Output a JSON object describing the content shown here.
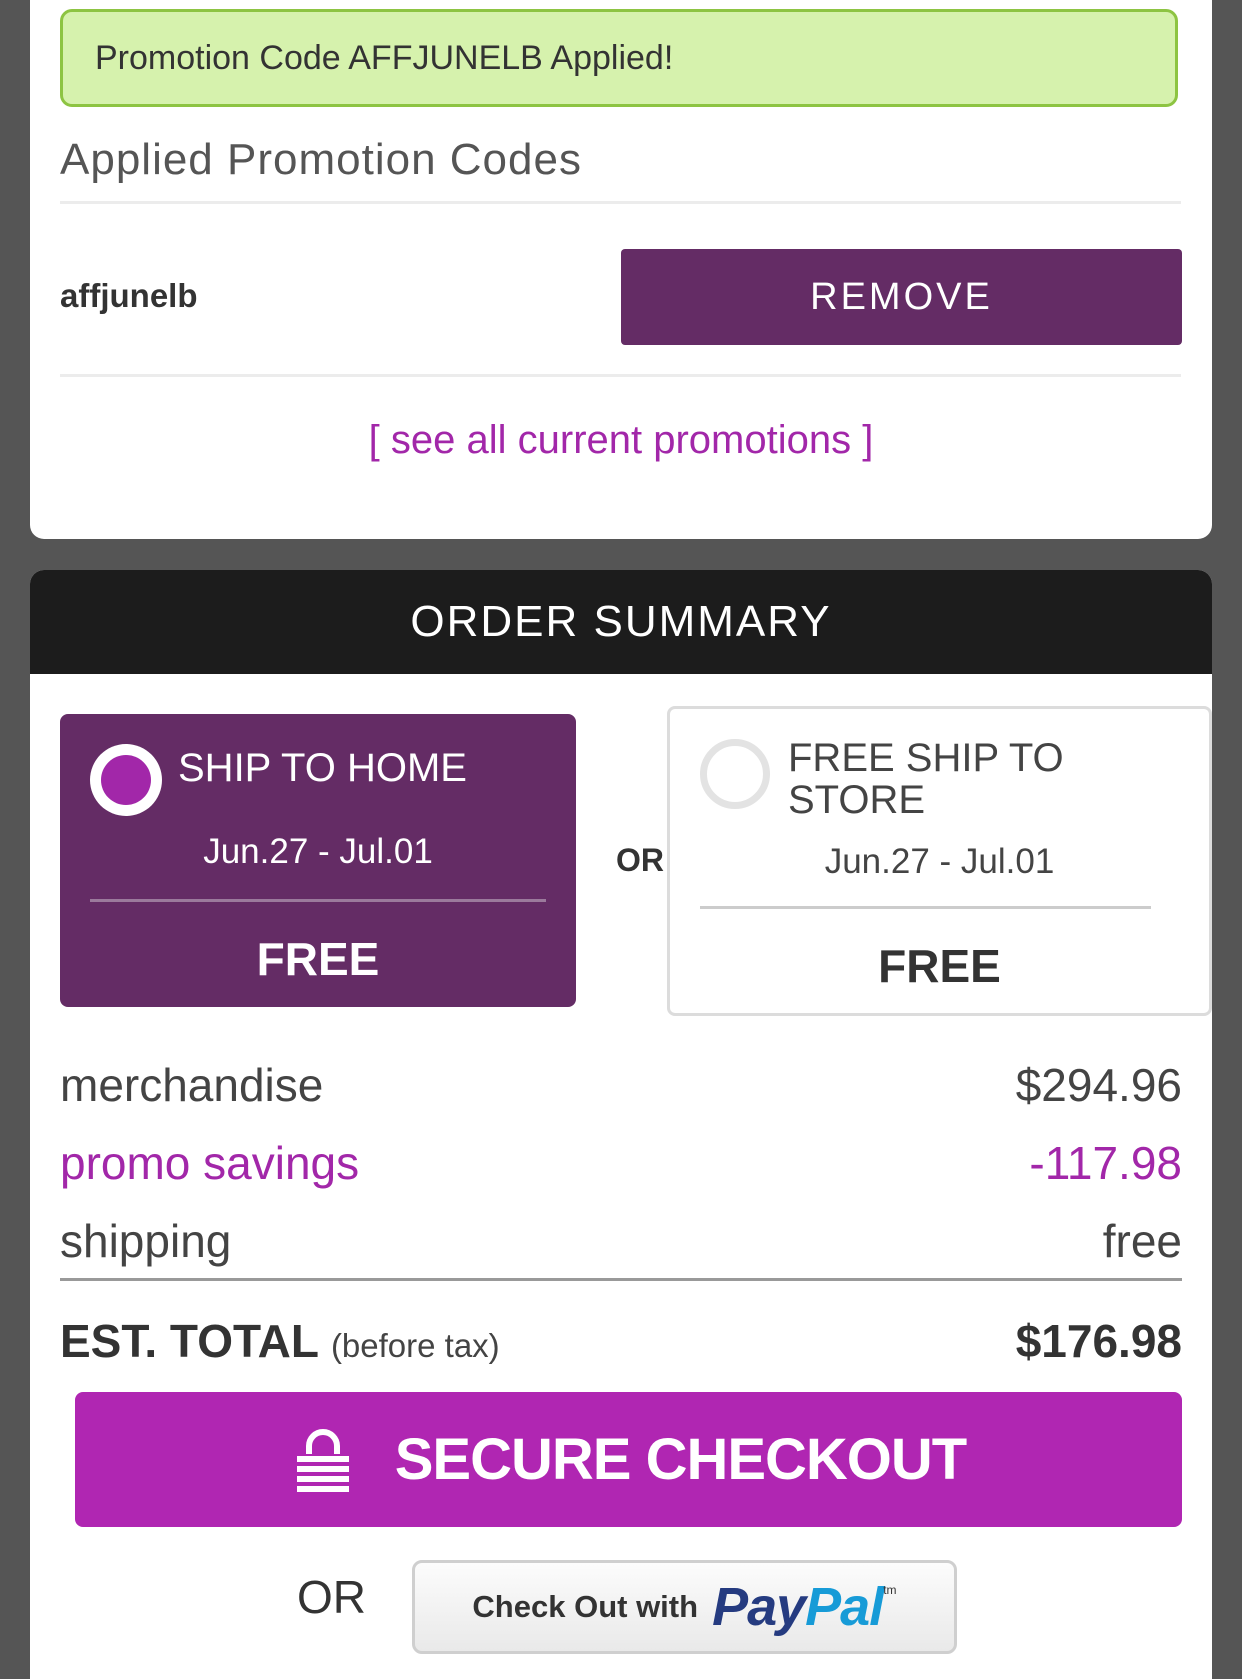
{
  "promo_banner": {
    "text": "Promotion Code AFFJUNELB Applied!"
  },
  "applied_codes": {
    "heading": "Applied Promotion Codes",
    "code": "affjunelb",
    "remove_label": "REMOVE",
    "see_all_link": "[ see all current promotions ]"
  },
  "order_summary": {
    "header": "ORDER SUMMARY",
    "ship_to_home": {
      "title": "SHIP TO HOME",
      "dates": "Jun.27 - Jul.01",
      "price": "FREE",
      "selected": true
    },
    "or_label": "OR",
    "ship_to_store": {
      "title": "FREE SHIP TO STORE",
      "dates": "Jun.27 - Jul.01",
      "price": "FREE",
      "selected": false
    },
    "lines": {
      "merchandise_label": "merchandise",
      "merchandise_value": "$294.96",
      "promo_label": "promo savings",
      "promo_value": "-117.98",
      "shipping_label": "shipping",
      "shipping_value": "free"
    },
    "total": {
      "label": "EST. TOTAL",
      "note": "(before tax)",
      "value": "$176.98"
    },
    "checkout_label": "SECURE CHECKOUT",
    "or_bottom": "OR",
    "paypal": {
      "text": "Check Out with",
      "logo_pay": "Pay",
      "logo_pal": "Pal",
      "tm": "tm"
    }
  },
  "colors": {
    "brand_purple": "#642c65",
    "accent_magenta": "#a227a9",
    "checkout_magenta": "#b026b2",
    "success_green": "#d6f2ad"
  },
  "icons": [
    "lock-icon",
    "radio-selected-icon",
    "radio-unselected-icon",
    "paypal-logo"
  ]
}
